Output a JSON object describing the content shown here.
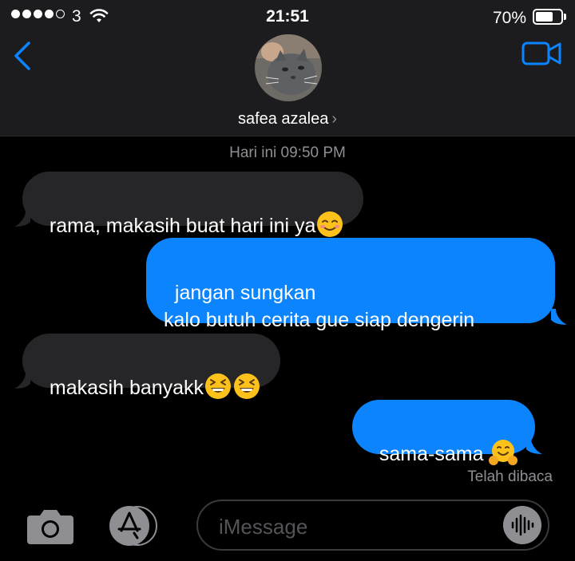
{
  "status": {
    "carrier": "3",
    "time": "21:51",
    "battery_pct": "70%",
    "battery_level": 0.7
  },
  "header": {
    "contact_name": "safea azalea",
    "chevron": "›",
    "back_icon": "chevron-left-icon",
    "video_icon": "video-camera-icon"
  },
  "conversation": {
    "timestamp": "Hari ini 09:50 PM",
    "messages": [
      {
        "direction": "in",
        "text": "rama, makasih buat hari ini ya",
        "emoji": [
          "smiling-face-icon"
        ]
      },
      {
        "direction": "out",
        "text": "jangan sungkan\nkalo butuh cerita gue siap dengerin"
      },
      {
        "direction": "in",
        "text": "makasih banyakk",
        "emoji": [
          "grinning-squinting-face-icon",
          "grinning-squinting-face-icon"
        ]
      },
      {
        "direction": "out",
        "text": "sama-sama ",
        "emoji": [
          "hugging-face-icon"
        ]
      }
    ],
    "read_receipt": "Telah dibaca"
  },
  "composer": {
    "placeholder": "iMessage",
    "camera_icon": "camera-icon",
    "apps_icon": "app-store-icon",
    "audio_icon": "audio-waveform-icon"
  },
  "colors": {
    "incoming_bubble": "#262628",
    "outgoing_bubble": "#0b84fe",
    "accent": "#0a84ff",
    "header_bg": "#1c1c1e"
  }
}
